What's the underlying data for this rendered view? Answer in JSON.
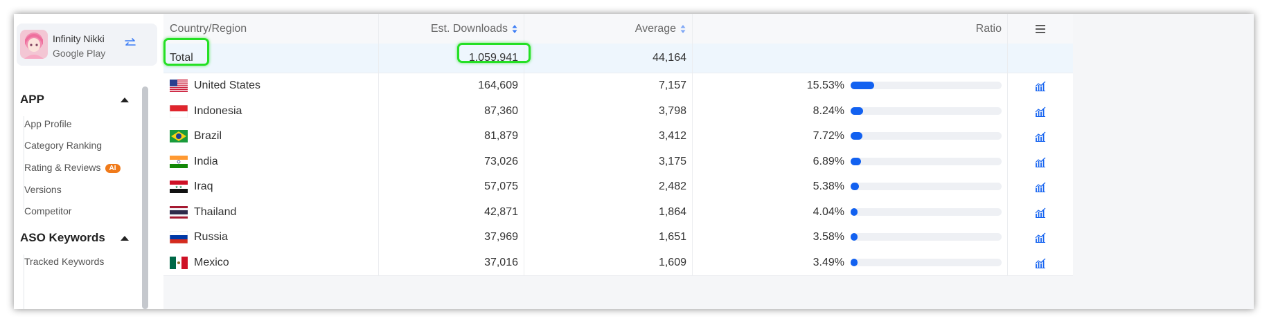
{
  "app": {
    "name": "Infinity Nikki",
    "store": "Google Play"
  },
  "sidebar": {
    "sections": [
      {
        "title": "APP",
        "items": [
          "App Profile",
          "Category Ranking",
          "Rating & Reviews",
          "Versions",
          "Competitor"
        ]
      },
      {
        "title": "ASO Keywords",
        "items": [
          "Tracked Keywords"
        ]
      }
    ],
    "ai_badge": "AI"
  },
  "table": {
    "columns": {
      "country": "Country/Region",
      "downloads": "Est. Downloads",
      "average": "Average",
      "ratio": "Ratio"
    },
    "total": {
      "label": "Total",
      "downloads": "1,059,941",
      "average": "44,164"
    },
    "rows": [
      {
        "country": "United States",
        "flag": "flag-us",
        "downloads": "164,609",
        "average": "7,157",
        "ratio": "15.53%",
        "ratio_value": 0.1553
      },
      {
        "country": "Indonesia",
        "flag": "flag-id",
        "downloads": "87,360",
        "average": "3,798",
        "ratio": "8.24%",
        "ratio_value": 0.0824
      },
      {
        "country": "Brazil",
        "flag": "flag-br",
        "downloads": "81,879",
        "average": "3,412",
        "ratio": "7.72%",
        "ratio_value": 0.0772
      },
      {
        "country": "India",
        "flag": "flag-in",
        "downloads": "73,026",
        "average": "3,175",
        "ratio": "6.89%",
        "ratio_value": 0.0689
      },
      {
        "country": "Iraq",
        "flag": "flag-iq",
        "downloads": "57,075",
        "average": "2,482",
        "ratio": "5.38%",
        "ratio_value": 0.0538
      },
      {
        "country": "Thailand",
        "flag": "flag-th",
        "downloads": "42,871",
        "average": "1,864",
        "ratio": "4.04%",
        "ratio_value": 0.0404
      },
      {
        "country": "Russia",
        "flag": "flag-ru",
        "downloads": "37,969",
        "average": "1,651",
        "ratio": "3.58%",
        "ratio_value": 0.0358
      },
      {
        "country": "Mexico",
        "flag": "flag-mx",
        "downloads": "37,016",
        "average": "1,609",
        "ratio": "3.49%",
        "ratio_value": 0.0349
      }
    ]
  },
  "colors": {
    "accent": "#1261f0",
    "highlight": "#25e025",
    "ai_badge": "#f07a1a"
  },
  "icons": [
    "switch-icon",
    "caret-up-icon",
    "sort-icon",
    "menu-icon",
    "chart-icon"
  ]
}
